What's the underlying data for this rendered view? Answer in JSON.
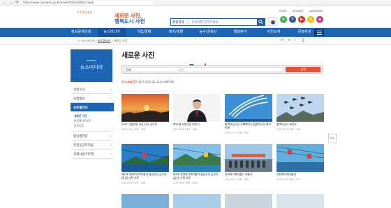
{
  "browser": {
    "back": "←",
    "forward": "→",
    "reload": "⟳",
    "url": "https://www.sacheon.go.kr/news/00021/00023.web"
  },
  "header": {
    "logo_sub": "우주항공중심",
    "logo_main": "Sacheon",
    "slogan_line1": "새로운 사천,",
    "slogan_line2": "행복도시 사천",
    "search_scope": "통합검색",
    "search_placeholder": "검색어를 입력하세요",
    "top_links": [
      "HOME",
      "SITEMAP",
      "LANGUAGE"
    ],
    "sns": [
      {
        "name": "blog",
        "glyph": "b",
        "color": "#3bb34a"
      },
      {
        "name": "facebook",
        "glyph": "f",
        "color": "#3b5998"
      },
      {
        "name": "youtube",
        "glyph": "▶",
        "color": "#e52d27"
      },
      {
        "name": "kakao",
        "glyph": "k",
        "color": "#f7c600"
      },
      {
        "name": "instagram",
        "glyph": "◎",
        "color": "#c13584"
      }
    ]
  },
  "gnb": {
    "items": [
      "정보공개안내",
      "뉴스미디어",
      "기업/경제",
      "복지/생활",
      "농수산/축산",
      "행정분야",
      "사천소개",
      "문화관광"
    ]
  },
  "breadcrumb": {
    "path": [
      "뉴스미디어",
      "포토갤러리"
    ],
    "current": "새로운 사진"
  },
  "sidebar": {
    "title": "뉴스미디어",
    "items": [
      {
        "label": "시정소식",
        "arrow": "+"
      },
      {
        "label": "시정홍보",
        "arrow": "+"
      },
      {
        "label": "포토갤러리",
        "arrow": "-"
      },
      {
        "label": "영상갤러리",
        "arrow": "+"
      },
      {
        "label": "추천공공저작물",
        "arrow": "+"
      },
      {
        "label": "고향사랑기부제",
        "arrow": "+"
      }
    ],
    "subs": [
      "새로운 사진",
      "분류별사진보기",
      "검색방법"
    ]
  },
  "main": {
    "title": "새로운 사진",
    "filter_select": "전체",
    "search_button": "검색",
    "count_prefix": "총 ",
    "count_num": "5,852건",
    "count_suffix": "의 글이 있습니다. (1/117페이지)"
  },
  "cards": [
    {
      "title": "2022 사천관광 사진 전국 공모전",
      "meta": "2022.10.06 | 조회 : 1283"
    },
    {
      "title": "제12대 사천시장 박동식",
      "meta": "2022.06.28 | 조회 : 1080"
    },
    {
      "title": "블랙이글스팀 국제에어쇼 참관대규모 홍보비행",
      "meta": "2020.10.27 | 조회 : 2266"
    },
    {
      "title": "블랙이글스 에어쇼",
      "meta": "2019.08.22 | 조회 : 2046"
    },
    {
      "title": "제1회 사천바다케이블카 관광사진 공모전 -[동상] 사천 보문",
      "meta": "2019.03.05 | 조회 : 3468"
    },
    {
      "title": "제1회 사천바다케이블카 관광사진 공모전 -[금상] 사천 보문",
      "meta": "2019.03.05 | 조회 : 3298"
    },
    {
      "title": "사천바다케이블카 개통식",
      "meta": "2018.04.20 | 조회 : 3096"
    },
    {
      "title": "사천바다케이블카",
      "meta": "2018.04.20 | 조회 : 3797"
    }
  ],
  "top_button": "TOP"
}
